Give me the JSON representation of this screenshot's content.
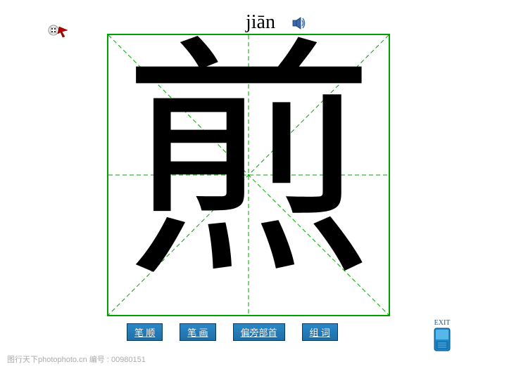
{
  "pinyin": "jiān",
  "character": "煎",
  "buttons": {
    "stroke_order": "笔 顺",
    "strokes": "笔 画",
    "radical": "偏旁部首",
    "words": "组 词"
  },
  "exit": {
    "label": "EXIT"
  },
  "watermark": "图行天下photophoto.cn  编号 : 00980151"
}
